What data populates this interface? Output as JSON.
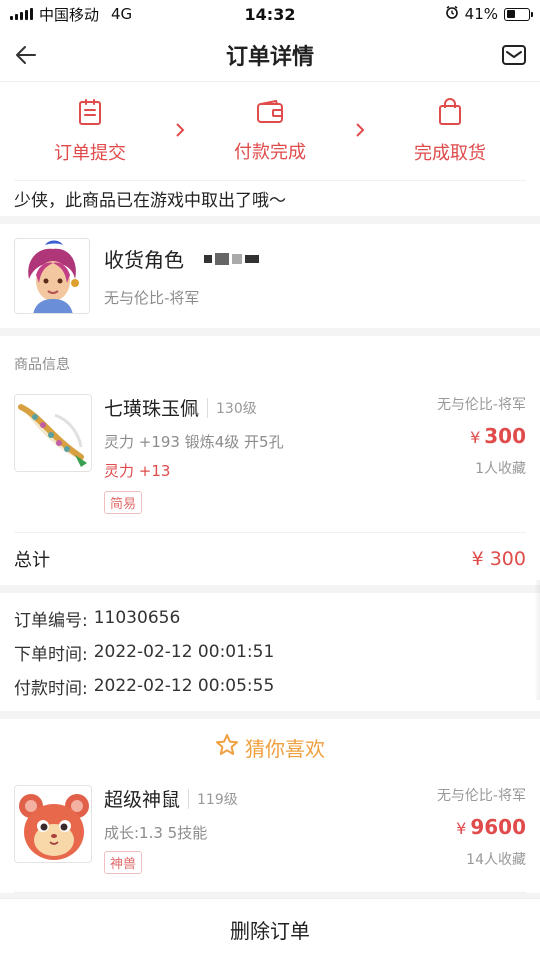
{
  "status_bar": {
    "carrier": "中国移动",
    "network": "4G",
    "time": "14:32",
    "battery": "41%",
    "battery_level": 0.41
  },
  "nav": {
    "title": "订单详情",
    "back_icon": "arrow-left-icon",
    "message_icon": "envelope-icon"
  },
  "steps": [
    {
      "label": "订单提交",
      "icon": "clipboard-icon"
    },
    {
      "label": "付款完成",
      "icon": "wallet-icon"
    },
    {
      "label": "完成取货",
      "icon": "shopping-bag-icon"
    }
  ],
  "notice": "少侠，此商品已在游戏中取出了哦～",
  "receiver": {
    "title": "收货角色",
    "server": "无与伦比-将军"
  },
  "goods": {
    "header": "商品信息",
    "item": {
      "name": "七璜珠玉佩",
      "level": "130级",
      "attr": "灵力 +193 锻炼4级 开5孔",
      "attr_red": "灵力 +13",
      "tag": "简易",
      "server": "无与伦比-将军",
      "currency": "¥",
      "price": "300",
      "favorites": "1人收藏"
    }
  },
  "total": {
    "label": "总计",
    "value": "¥ 300"
  },
  "order_info": {
    "order_no_label": "订单编号:",
    "order_no": "11030656",
    "order_time_label": "下单时间:",
    "order_time": "2022-02-12 00:01:51",
    "pay_time_label": "付款时间:",
    "pay_time": "2022-02-12 00:05:55"
  },
  "recommend": {
    "title": "猜你喜欢",
    "item": {
      "name": "超级神鼠",
      "level": "119级",
      "attr": "成长:1.3 5技能",
      "tag": "神兽",
      "server": "无与伦比-将军",
      "currency": "¥",
      "price": "9600",
      "favorites": "14人收藏"
    }
  },
  "delete_button": "删除订单",
  "colors": {
    "accent_red": "#e04b4b",
    "star_orange": "#f0a040"
  }
}
